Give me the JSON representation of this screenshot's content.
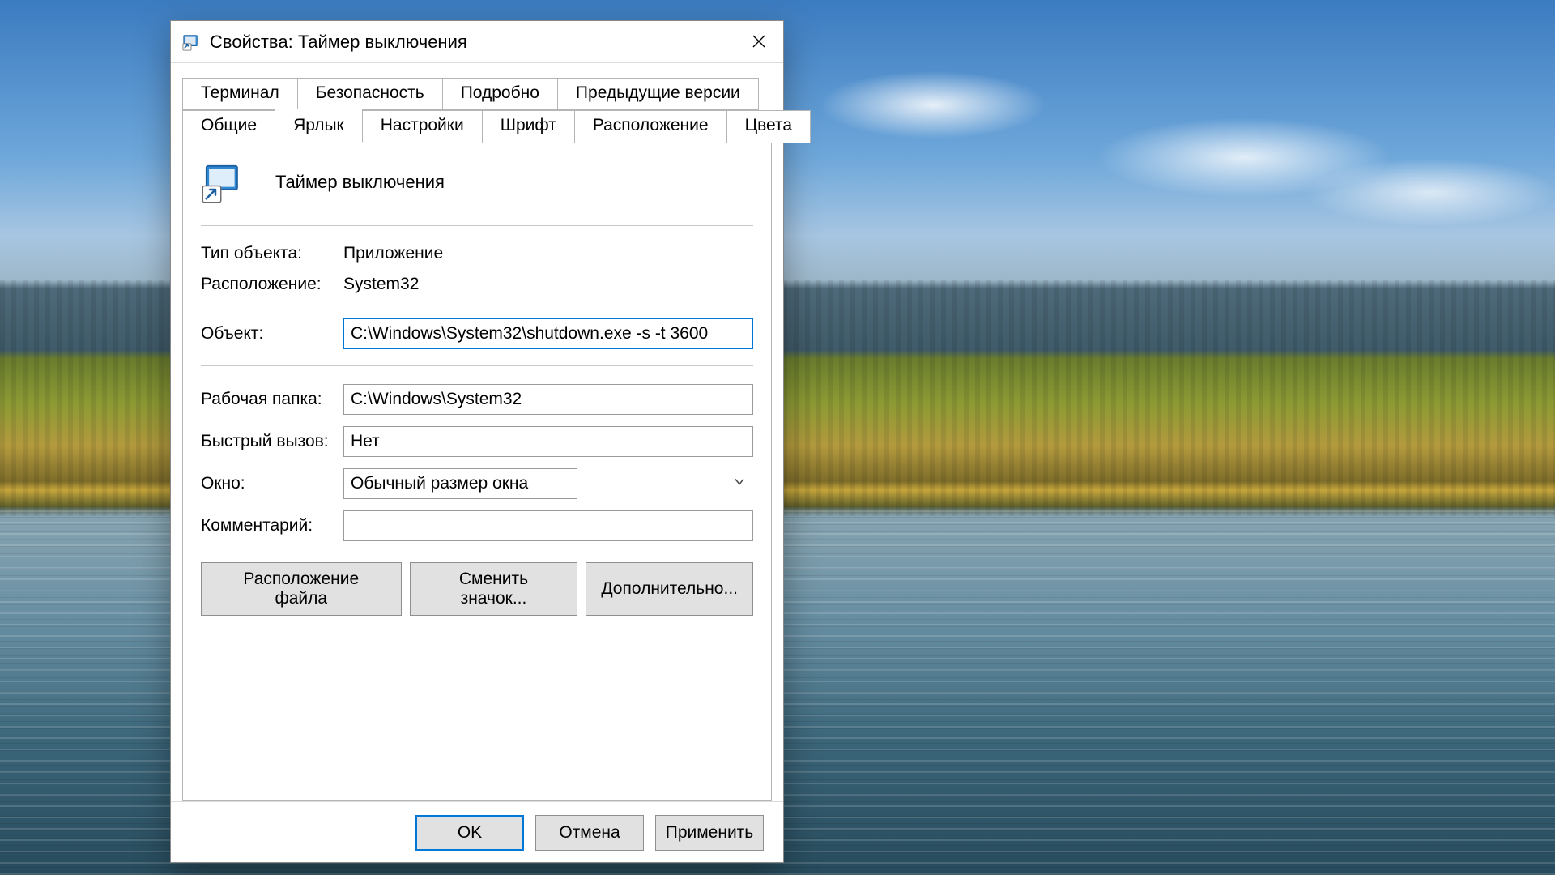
{
  "window": {
    "title": "Свойства: Таймер выключения"
  },
  "tabs": {
    "row1": [
      "Терминал",
      "Безопасность",
      "Подробно",
      "Предыдущие версии"
    ],
    "row2": [
      "Общие",
      "Ярлык",
      "Настройки",
      "Шрифт",
      "Расположение",
      "Цвета"
    ],
    "active": "Ярлык"
  },
  "shortcut": {
    "name": "Таймер выключения",
    "object_type_label": "Тип объекта:",
    "object_type_value": "Приложение",
    "location_label": "Расположение:",
    "location_value": "System32",
    "target_label": "Объект:",
    "target_value": "C:\\Windows\\System32\\shutdown.exe -s -t 3600",
    "start_in_label": "Рабочая папка:",
    "start_in_value": "C:\\Windows\\System32",
    "shortcut_key_label": "Быстрый вызов:",
    "shortcut_key_value": "Нет",
    "run_label": "Окно:",
    "run_value": "Обычный размер окна",
    "comment_label": "Комментарий:",
    "comment_value": ""
  },
  "buttons": {
    "open_location": "Расположение файла",
    "change_icon": "Сменить значок...",
    "advanced": "Дополнительно...",
    "ok": "OK",
    "cancel": "Отмена",
    "apply": "Применить"
  }
}
